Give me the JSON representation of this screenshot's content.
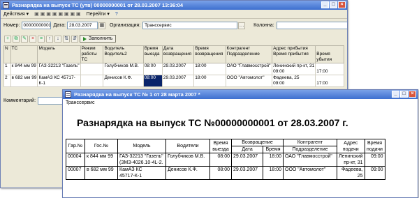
{
  "win1": {
    "title": "Разнарядка на выпуск ТС (утв) 00000000001 от 28.03.2007 13:36:04",
    "menu": [
      "Действия ▾",
      "Перейти ▾"
    ],
    "form": {
      "number_label": "Номер:",
      "number_value": "00000000001",
      "date_label": "Дата:",
      "date_value": "28.03.2007",
      "org_label": "Организация:",
      "org_value": "Трансcервис",
      "column_label": "Колонна:",
      "column_value": ""
    },
    "fill_button": "Заполнить",
    "table": {
      "headers": [
        [
          "N",
          ""
        ],
        [
          "ТС",
          ""
        ],
        [
          "Модель",
          ""
        ],
        [
          "Режим",
          "работы ТС"
        ],
        [
          "Водитель",
          "Водитель2"
        ],
        [
          "Время",
          "выезда"
        ],
        [
          "Дата",
          "возвращения"
        ],
        [
          "Время",
          "возвращения"
        ],
        [
          "Контрагент",
          "Подразделение"
        ],
        [
          "Адрес прибытия",
          "Время прибытия"
        ],
        [
          "",
          "Время убытия"
        ]
      ],
      "rows": [
        {
          "n": "1",
          "ts": "к 844 мм 99",
          "model": "ГАЗ-32213 \"Газель\"",
          "mode": "",
          "driver": "Голубчиков М.В.",
          "dep_time": "08:00",
          "ret_date": "29.03.2007",
          "ret_time": "18:00",
          "contractor": "ОАО \"Главмосстрой\"",
          "address": "Ленинский пр-кт, 31",
          "arr_time": "09:00",
          "leave_time": "17:00"
        },
        {
          "n": "2",
          "ts": "в 682 мм 99",
          "model": "КамАЗ КС 45717-К-1",
          "mode": "",
          "driver": "Денисов К.Ф.",
          "dep_time": "08:00",
          "ret_date": "29.03.2007",
          "ret_time": "18:00",
          "contractor": "ООО \"Автомолот\"",
          "address": "Фадеева, 25",
          "arr_time": "09:00",
          "leave_time": "17:00"
        }
      ]
    },
    "comment_label": "Комментарий:"
  },
  "win2": {
    "title": "Разнарядка на выпуск ТС № 1 от 28 марта 2007 *",
    "org": "Трансcервис",
    "heading": "Разнарядка на выпуск ТС №00000000001 от 28.03.2007 г.",
    "table": {
      "headers": {
        "gar": "Гар.№",
        "gos": "Гос.№",
        "model": "Модель",
        "drivers": "Водители",
        "dep_time": "Время выезда",
        "return": "Возвращение",
        "ret_date": "Дата",
        "ret_time": "Время",
        "contractor": "Контрагент",
        "division": "Подразделение",
        "address": "Адрес подачи",
        "time": "Время подачи"
      },
      "rows": [
        {
          "gar": "00004",
          "gos": "к 844 мм 99",
          "model": "ГАЗ-32213 \"Газель\"",
          "model2": "(ЗМЗ-4026.10-4L-2.",
          "driver": "Голубчиков М.В.",
          "dep_time": "08:00",
          "ret_date": "29.03.2007",
          "ret_time": "18:00",
          "contractor": "ОАО \"Главмосстрой\"",
          "address": "Ленинский",
          "address2": "пр-кт, 31",
          "time": "09:00"
        },
        {
          "gar": "00007",
          "gos": "в 682 мм 99",
          "model": "КамАЗ КС",
          "model2": "45717-К-1",
          "driver": "Денисов К.Ф.",
          "dep_time": "08:00",
          "ret_date": "29.03.2007",
          "ret_time": "18:00",
          "contractor": "ООО \"Автомолот\"",
          "address": "Фадеева,",
          "address2": "25",
          "time": "09:00"
        }
      ]
    }
  }
}
